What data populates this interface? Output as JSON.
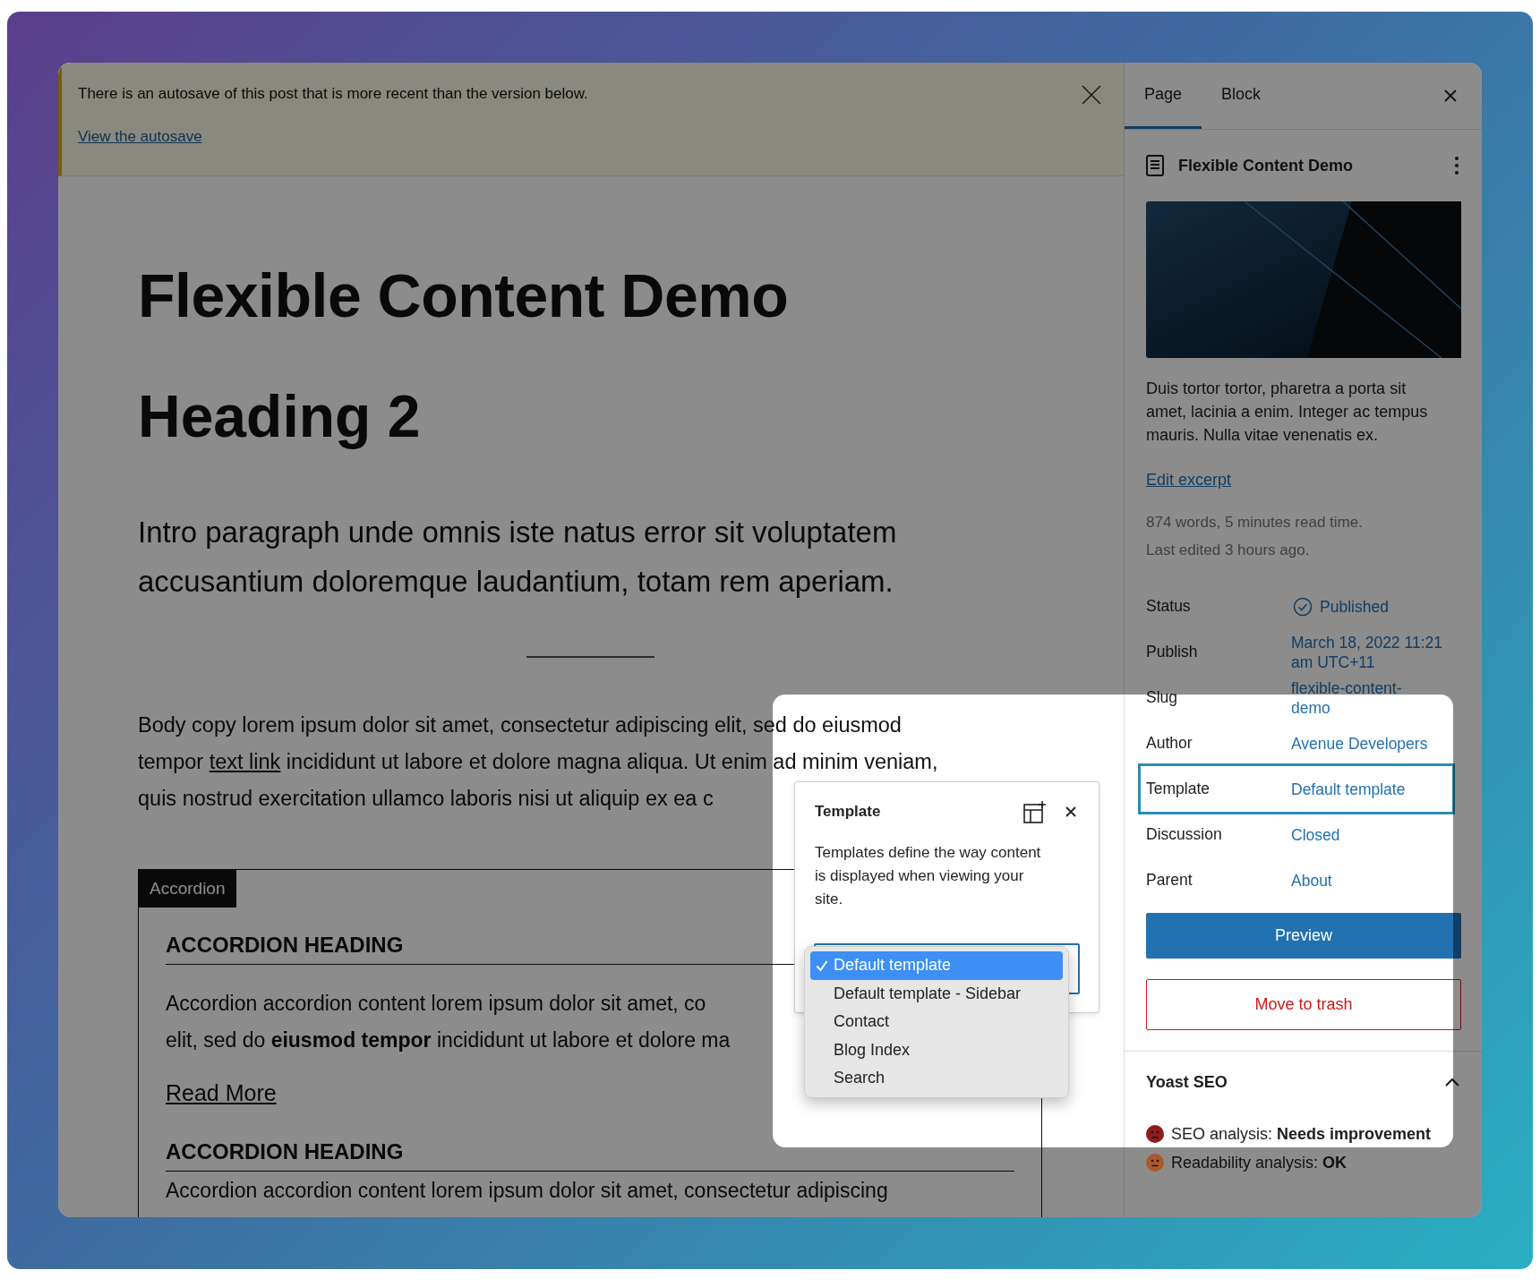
{
  "notice": {
    "text": "There is an autosave of this post that is more recent than the version below.",
    "link": "View the autosave"
  },
  "editor": {
    "title": "Flexible Content Demo",
    "heading": "Heading 2",
    "intro": "Intro paragraph unde omnis iste natus error sit voluptatem accusantium doloremque laudantium, totam rem aperiam.",
    "body_lines": [
      {
        "before": "Body copy lorem ipsum dolor sit amet, consectetur adipiscing elit, sed do eiusmod"
      },
      {
        "before": "tempor ",
        "link": "text link",
        "after": " incididunt ut labore et dolore magna aliqua. Ut enim ad minim veniam,"
      },
      {
        "before": "quis nostrud exercitation ullamco laboris nisi ut aliquip ex ea c"
      }
    ],
    "accordion": {
      "tag": "Accordion",
      "items": [
        {
          "heading": "ACCORDION HEADING",
          "lines": [
            "Accordion accordion content lorem ipsum dolor sit amet, co",
            "elit, sed do **eiusmod tempor** incididunt ut labore et dolore ma"
          ],
          "link": "Read More"
        },
        {
          "heading": "ACCORDION HEADING",
          "lines": [
            "Accordion accordion content lorem ipsum dolor sit amet, consectetur adipiscing"
          ]
        }
      ]
    }
  },
  "sidebar": {
    "tabs": [
      {
        "label": "Page",
        "selected": true
      },
      {
        "label": "Block",
        "selected": false
      }
    ],
    "document_title": "Flexible Content Demo",
    "excerpt": "Duis tortor tortor, pharetra a porta sit amet, lacinia a enim. Integer ac tempus mauris. Nulla vitae venenatis ex.",
    "edit_excerpt": "Edit excerpt",
    "stats": [
      "874 words, 5 minutes read time.",
      "Last edited 3 hours ago."
    ],
    "fields": [
      {
        "kind": "status",
        "label": "Status",
        "value": "Published",
        "highlighted": false
      },
      {
        "kind": "link",
        "label": "Publish",
        "value": "March 18, 2022 11:21 am UTC+11",
        "highlighted": false
      },
      {
        "kind": "link",
        "label": "Slug",
        "value": "flexible-content-demo",
        "highlighted": false
      },
      {
        "kind": "link",
        "label": "Author",
        "value": "Avenue Developers",
        "highlighted": false
      },
      {
        "kind": "link",
        "label": "Template",
        "value": "Default template",
        "highlighted": true
      },
      {
        "kind": "link",
        "label": "Discussion",
        "value": "Closed",
        "highlighted": false
      },
      {
        "kind": "link",
        "label": "Parent",
        "value": "About",
        "highlighted": false
      }
    ],
    "preview_button": "Preview",
    "trash_button": "Move to trash",
    "yoast": {
      "title": "Yoast SEO",
      "expanded": true,
      "analyses": [
        {
          "label": "SEO analysis: ",
          "result": "Needs improvement",
          "color": "#8e1d1d",
          "kind": "sad"
        },
        {
          "label": "Readability analysis: ",
          "result": "OK",
          "color": "#a9592a",
          "kind": "neutral"
        }
      ]
    }
  },
  "template_popover": {
    "title": "Template",
    "description": "Templates define the way content is displayed when viewing your site.",
    "options": [
      {
        "label": "Default template",
        "selected": true
      },
      {
        "label": "Default template - Sidebar",
        "selected": false
      },
      {
        "label": "Contact",
        "selected": false
      },
      {
        "label": "Blog Index",
        "selected": false
      },
      {
        "label": "Search",
        "selected": false
      }
    ]
  }
}
